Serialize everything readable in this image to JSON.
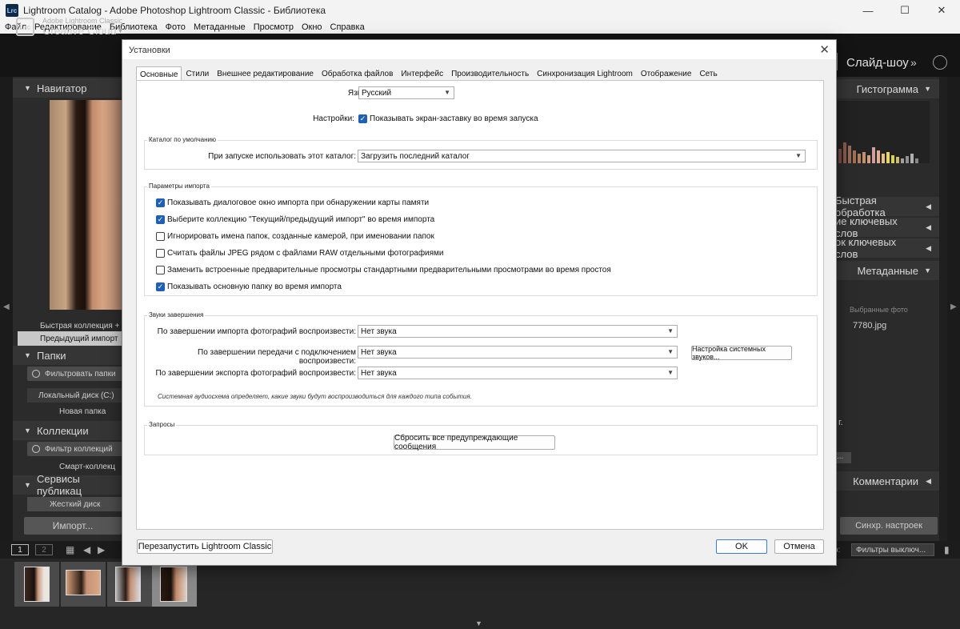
{
  "window": {
    "title": "Lightroom Catalog - Adobe Photoshop Lightroom Classic - Библиотека",
    "app_icon": "Lrc",
    "minimize": "—",
    "maximize": "☐",
    "close": "✕"
  },
  "menubar": [
    "Файл",
    "Редактирование",
    "Библиотека",
    "Фото",
    "Метаданные",
    "Просмотр",
    "Окно",
    "Справка"
  ],
  "lightroom": {
    "badge": "Lrc",
    "brand_small": "Adobe Lightroom Classic",
    "brand_big": "Creative Cloud",
    "module": "Слайд-шоу",
    "module_more": "»",
    "left": {
      "navigator": "Навигатор",
      "quick_collection": "Быстрая коллекция  +",
      "previous_import": "Предыдущий импорт",
      "folders": "Папки",
      "filter_folders": "Фильтровать папки",
      "local_disk": "Локальный диск (C:)",
      "new_folder": "Новая папка",
      "collections": "Коллекции",
      "filter_collections": "Фильтр коллекций",
      "smart_collections": "Смарт-коллекц",
      "publish_services": "Сервисы публикац",
      "hard_disk": "Жесткий диск",
      "import_button": "Импорт..."
    },
    "right": {
      "histogram": "Гистограмма",
      "quick_develop": "Быстрая обработка",
      "keywording": "ие ключевых слов",
      "keyword_list": "ок ключевых слов",
      "metadata": "Метаданные",
      "selected_photos": "Выбранные фото",
      "filename": "7780.jpg",
      "comments": "Комментарии",
      "sync_button": "Синхр. настроек",
      "truncated_g": "г.",
      "truncated_btn": "..."
    },
    "toolbar": {
      "view1": "1",
      "view2": "2",
      "filter_label": "р:",
      "filter_value": "Фильтры выключ..."
    }
  },
  "dialog": {
    "title": "Установки",
    "close": "✕",
    "tabs": [
      {
        "label": "Основные",
        "active": true
      },
      {
        "label": "Стили",
        "active": false
      },
      {
        "label": "Внешнее редактирование",
        "active": false
      },
      {
        "label": "Обработка файлов",
        "active": false
      },
      {
        "label": "Интерфейс",
        "active": false
      },
      {
        "label": "Производительность",
        "active": false
      },
      {
        "label": "Синхронизация Lightroom",
        "active": false
      },
      {
        "label": "Отображение",
        "active": false
      },
      {
        "label": "Сеть",
        "active": false
      }
    ],
    "language_label": "Язык:",
    "language_value": "Русский",
    "settings_label": "Настройки:",
    "splash_label": "Показывать экран-заставку во время запуска",
    "splash_checked": true,
    "catalog": {
      "title": "Каталог по умолчанию",
      "label": "При запуске использовать этот каталог:",
      "value": "Загрузить последний каталог"
    },
    "import": {
      "title": "Параметры импорта",
      "options": [
        {
          "label": "Показывать диалоговое окно импорта при обнаружении карты памяти",
          "checked": true
        },
        {
          "label": "Выберите коллекцию \"Текущий/предыдущий импорт\" во время импорта",
          "checked": true
        },
        {
          "label": "Игнорировать имена папок, созданные камерой, при именовании папок",
          "checked": false
        },
        {
          "label": "Считать файлы JPEG рядом с файлами RAW отдельными фотографиями",
          "checked": false
        },
        {
          "label": "Заменить встроенные предварительные просмотры стандартными предварительными просмотрами во время простоя",
          "checked": false
        },
        {
          "label": "Показывать основную папку во время импорта",
          "checked": true
        }
      ]
    },
    "sounds": {
      "title": "Звуки завершения",
      "import_label": "По завершении импорта фотографий воспроизвести:",
      "import_value": "Нет звука",
      "tether_label": "По завершении передачи с подключением воспроизвести:",
      "tether_value": "Нет звука",
      "export_label": "По завершении экспорта фотографий воспроизвести:",
      "export_value": "Нет звука",
      "system_sounds_button": "Настройка системных звуков...",
      "note": "Системная аудиосхема определяет, какие звуки будут воспроизводиться для каждого типа события."
    },
    "prompts": {
      "title": "Запросы",
      "reset_button": "Сбросить все предупреждающие сообщения"
    },
    "restart_button": "Перезапустить Lightroom Classic",
    "ok_button": "OK",
    "cancel_button": "Отмена"
  },
  "colors": {
    "checkbox_on": "#1f5fb4",
    "default_button_border": "#3b7cd8",
    "lr_background": "#1f1f1f"
  }
}
